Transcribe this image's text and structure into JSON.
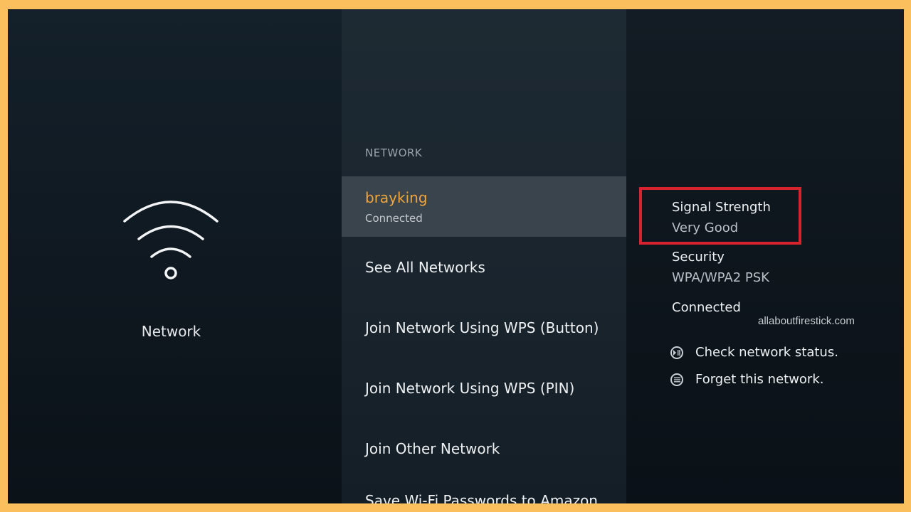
{
  "left": {
    "icon": "wifi-icon",
    "label": "Network"
  },
  "middle": {
    "section_header": "NETWORK",
    "selected_network": {
      "name": "brayking",
      "status": "Connected"
    },
    "items": [
      "See All Networks",
      "Join Network Using WPS (Button)",
      "Join Network Using WPS (PIN)",
      "Join Other Network",
      "Save Wi-Fi Passwords to Amazon"
    ]
  },
  "right": {
    "signal_label": "Signal Strength",
    "signal_value": "Very Good",
    "security_label": "Security",
    "security_value": "WPA/WPA2 PSK",
    "connection_label": "Connected",
    "actions": [
      {
        "icon": "play-pause-icon",
        "label": "Check network status."
      },
      {
        "icon": "menu-icon",
        "label": "Forget this network."
      }
    ]
  },
  "watermark": "allaboutfirestick.com",
  "colors": {
    "accent": "#f0a53a",
    "highlight_border": "#d6232e",
    "page_border": "#fbbf5e"
  }
}
